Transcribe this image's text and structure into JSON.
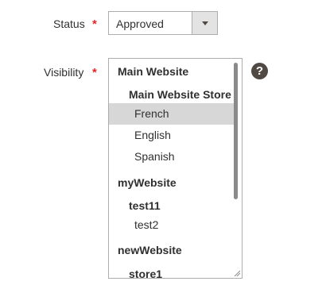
{
  "status_field": {
    "label": "Status",
    "required_mark": "*",
    "selected_value": "Approved",
    "dropdown_icon": "chevron-down-icon"
  },
  "visibility_field": {
    "label": "Visibility",
    "required_mark": "*",
    "help_icon": "help-icon",
    "help_symbol": "?",
    "options": [
      {
        "label": "Main Website",
        "level": 0,
        "selected": false
      },
      {
        "label": "Main Website Store",
        "level": 1,
        "selected": false
      },
      {
        "label": "French",
        "level": 2,
        "selected": true
      },
      {
        "label": "English",
        "level": 2,
        "selected": false
      },
      {
        "label": "Spanish",
        "level": 2,
        "selected": false
      },
      {
        "label": "myWebsite",
        "level": 0,
        "selected": false
      },
      {
        "label": "test11",
        "level": 1,
        "selected": false
      },
      {
        "label": "test2",
        "level": 2,
        "selected": false
      },
      {
        "label": "newWebsite",
        "level": 0,
        "selected": false
      },
      {
        "label": "store1",
        "level": 1,
        "selected": false
      }
    ]
  },
  "colors": {
    "required_star": "#e22626",
    "selected_option_bg": "#d7d7d7",
    "help_icon_bg": "#514943"
  }
}
